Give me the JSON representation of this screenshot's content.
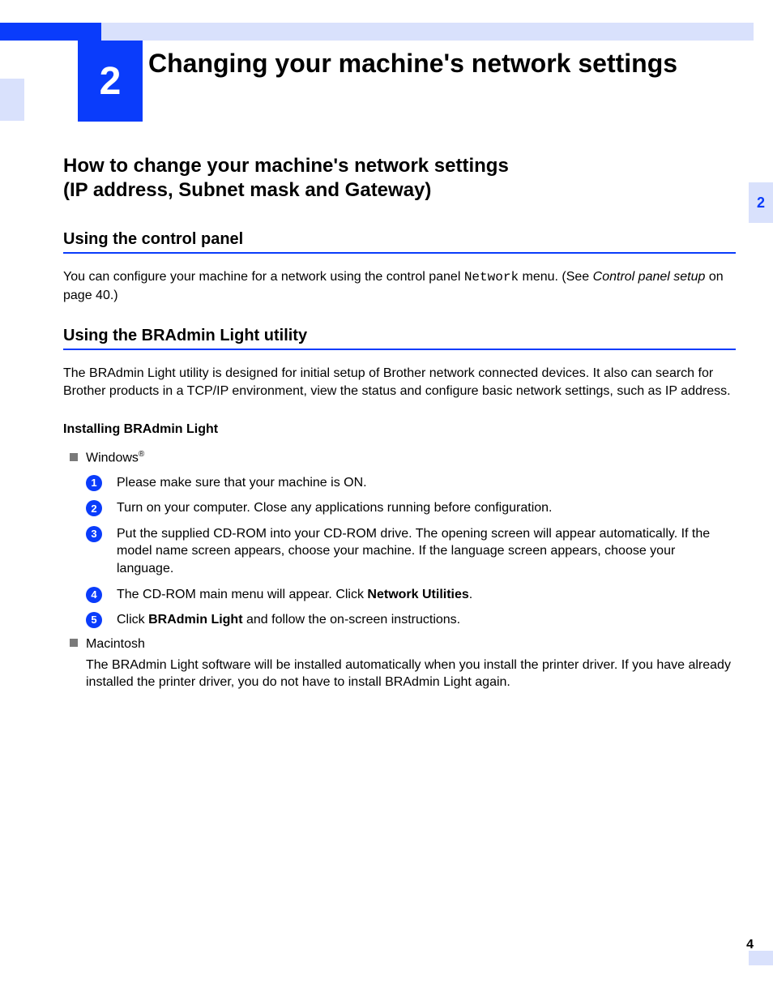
{
  "chapter": {
    "number": "2",
    "title": "Changing your machine's network settings"
  },
  "sideTab": "2",
  "section": {
    "heading_line1": "How to change your machine's network settings",
    "heading_line2": "(IP address, Subnet mask and Gateway)"
  },
  "sub1": {
    "heading": "Using the control panel",
    "p_pre": "You can configure your machine for a network using the control panel ",
    "p_mono": "Network",
    "p_mid": " menu. (See ",
    "p_ital": "Control panel setup",
    "p_post": " on page 40.)"
  },
  "sub2": {
    "heading": "Using the BRAdmin Light utility",
    "p": "The BRAdmin Light utility is designed for initial setup of Brother network connected devices. It also can search for Brother products in a TCP/IP environment, view the status and configure basic network settings, such as IP address."
  },
  "install": {
    "heading": "Installing BRAdmin Light",
    "windows_label": "Windows",
    "windows_reg": "®",
    "steps": [
      "Please make sure that your machine is ON.",
      "Turn on your computer. Close any applications running before configuration.",
      "Put the supplied CD-ROM into your CD-ROM drive. The opening screen will appear automatically. If the model name screen appears, choose your machine. If the language screen appears, choose your language."
    ],
    "step4_pre": "The CD-ROM main menu will appear. Click ",
    "step4_bold": "Network Utilities",
    "step4_post": ".",
    "step5_pre": "Click ",
    "step5_bold": "BRAdmin Light",
    "step5_post": " and follow the on-screen instructions.",
    "mac_label": "Macintosh",
    "mac_p": "The BRAdmin Light software will be installed automatically when you install the printer driver. If you have already installed the printer driver, you do not have to install BRAdmin Light again."
  },
  "pageNumber": "4"
}
